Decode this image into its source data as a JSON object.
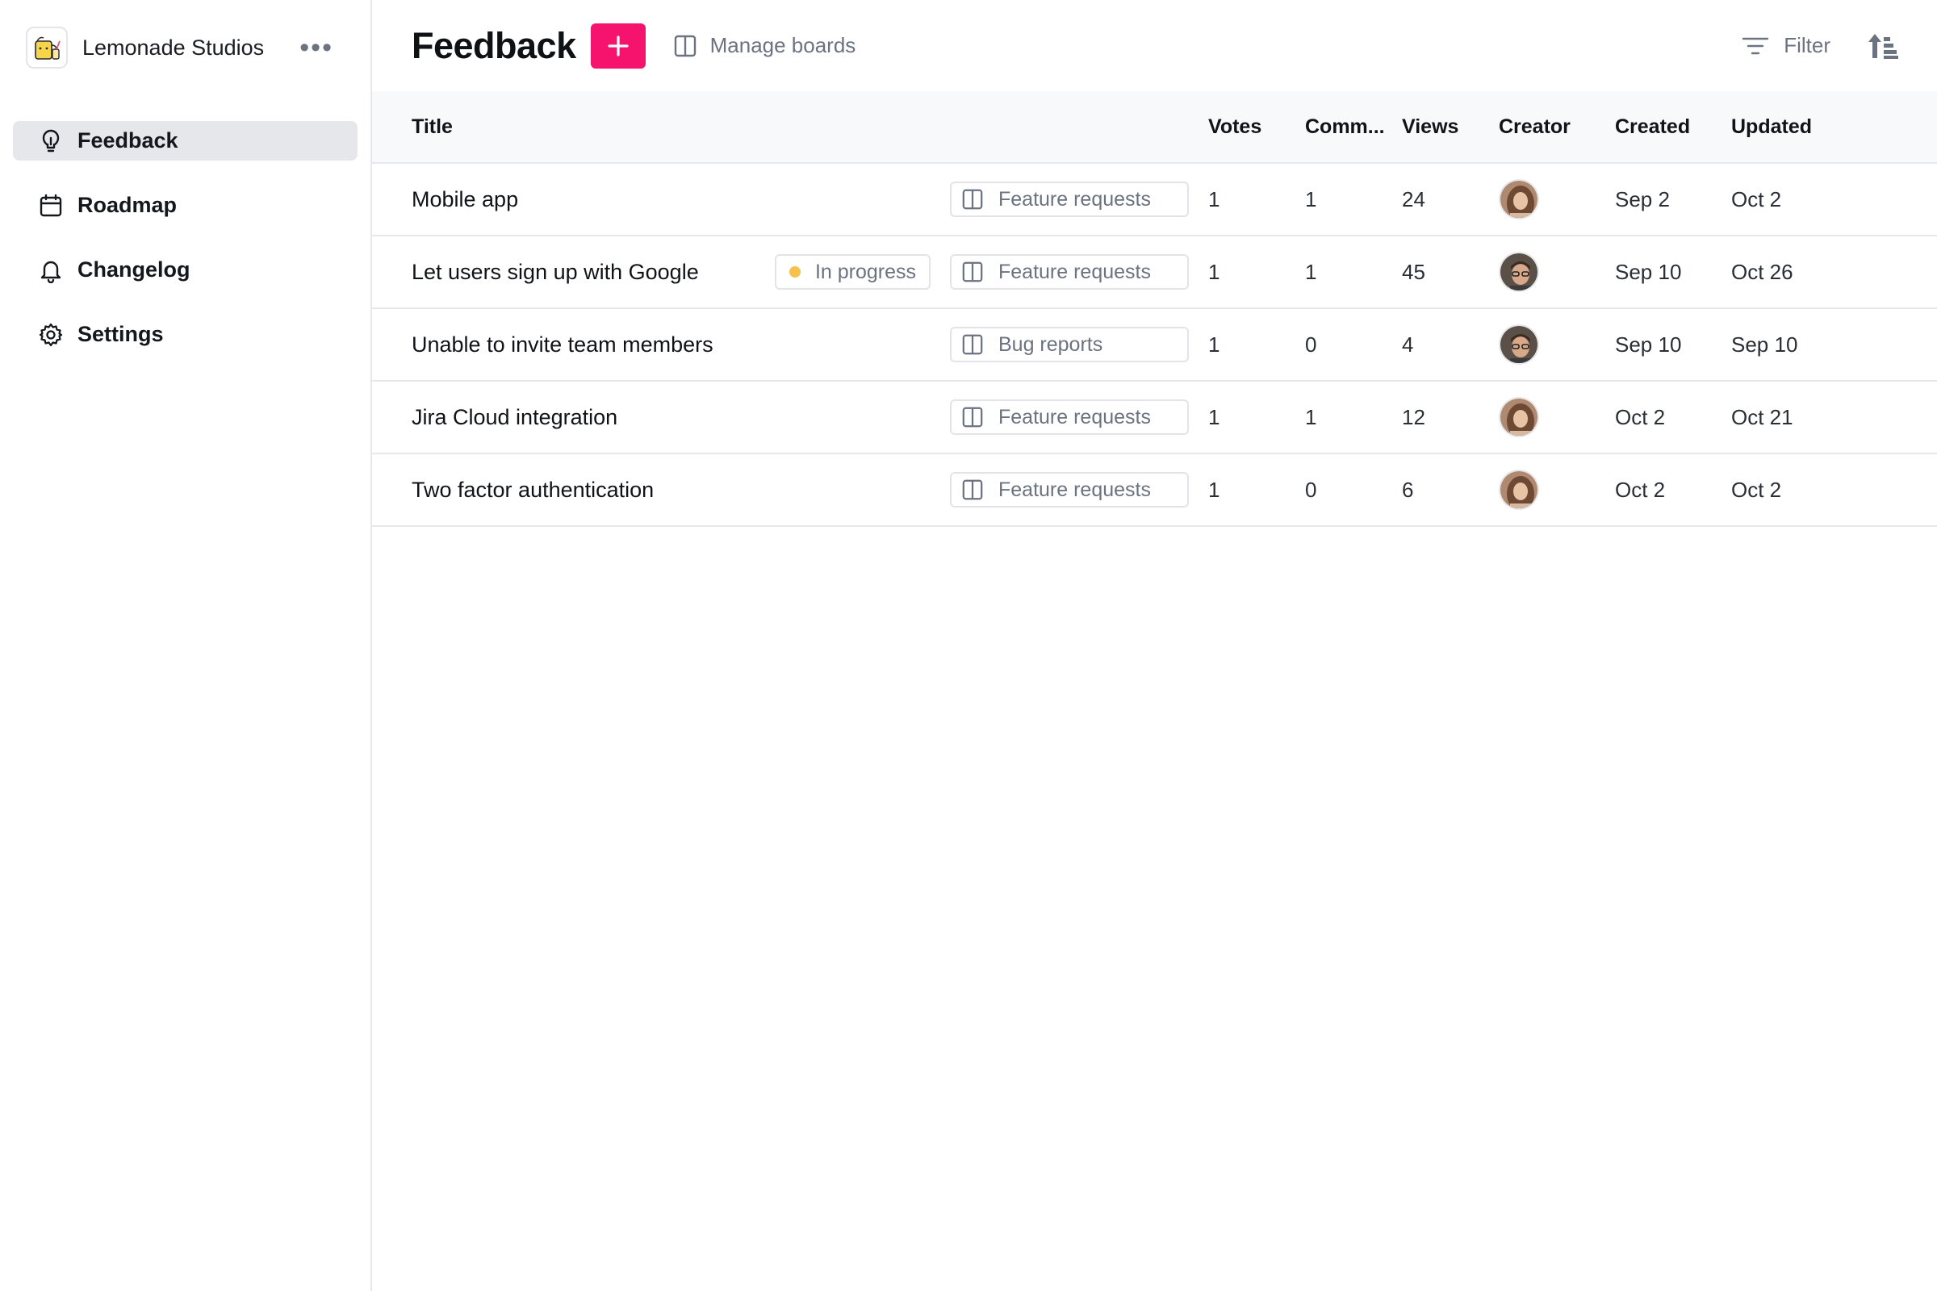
{
  "sidebar": {
    "workspace_name": "Lemonade Studios",
    "more": "•••",
    "items": [
      {
        "label": "Feedback",
        "icon": "lightbulb-icon",
        "active": true
      },
      {
        "label": "Roadmap",
        "icon": "calendar-icon",
        "active": false
      },
      {
        "label": "Changelog",
        "icon": "bell-icon",
        "active": false
      },
      {
        "label": "Settings",
        "icon": "gear-icon",
        "active": false
      }
    ]
  },
  "header": {
    "title": "Feedback",
    "add_label": "+",
    "manage_boards": "Manage boards",
    "filter": "Filter"
  },
  "table": {
    "columns": [
      "Title",
      "Votes",
      "Comm...",
      "Views",
      "Creator",
      "Created",
      "Updated"
    ],
    "rows": [
      {
        "title": "Mobile app",
        "status": "",
        "board": "Feature requests",
        "votes": "1",
        "comments": "1",
        "views": "24",
        "creator": "avatar-woman",
        "created": "Sep 2",
        "updated": "Oct 2"
      },
      {
        "title": "Let users sign up with Google",
        "status": "In progress",
        "board": "Feature requests",
        "votes": "1",
        "comments": "1",
        "views": "45",
        "creator": "avatar-man",
        "created": "Sep 10",
        "updated": "Oct 26"
      },
      {
        "title": "Unable to invite team members",
        "status": "",
        "board": "Bug reports",
        "votes": "1",
        "comments": "0",
        "views": "4",
        "creator": "avatar-man",
        "created": "Sep 10",
        "updated": "Sep 10"
      },
      {
        "title": "Jira Cloud integration",
        "status": "",
        "board": "Feature requests",
        "votes": "1",
        "comments": "1",
        "views": "12",
        "creator": "avatar-woman",
        "created": "Oct 2",
        "updated": "Oct 21"
      },
      {
        "title": "Two factor authentication",
        "status": "",
        "board": "Feature requests",
        "votes": "1",
        "comments": "0",
        "views": "6",
        "creator": "avatar-woman",
        "created": "Oct 2",
        "updated": "Oct 2"
      }
    ]
  },
  "colors": {
    "accent": "#f5136e",
    "status_in_progress": "#f7c24b",
    "active_nav": "#e5e7eb"
  }
}
